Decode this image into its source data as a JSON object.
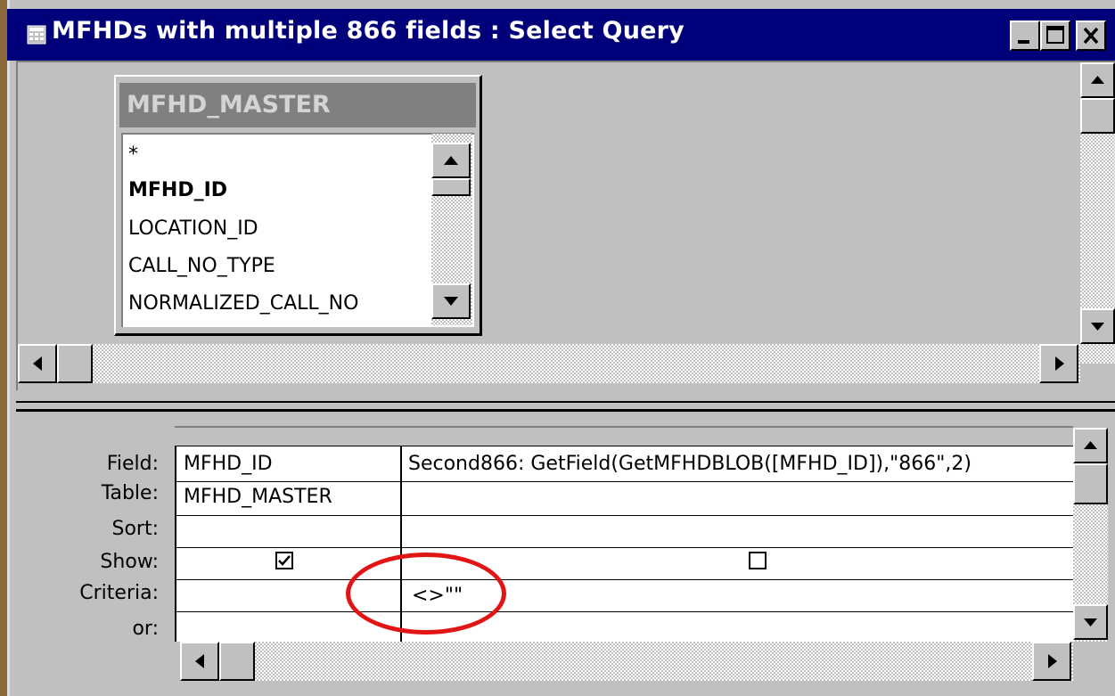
{
  "window": {
    "title": "MFHDs with multiple 866 fields : Select Query"
  },
  "table_box": {
    "title": "MFHD_MASTER",
    "fields": [
      "*",
      "MFHD_ID",
      "LOCATION_ID",
      "CALL_NO_TYPE",
      "NORMALIZED_CALL_NO"
    ],
    "bold_field": "MFHD_ID"
  },
  "grid": {
    "row_labels": [
      "Field:",
      "Table:",
      "Sort:",
      "Show:",
      "Criteria:",
      "or:"
    ],
    "columns": [
      {
        "field": "MFHD_ID",
        "table": "MFHD_MASTER",
        "sort": "",
        "show": true,
        "criteria": "",
        "or": ""
      },
      {
        "field": "Second866: GetField(GetMFHDBLOB([MFHD_ID]),\"866\",2)",
        "table": "",
        "sort": "",
        "show": false,
        "criteria": "<>\"\"",
        "or": ""
      }
    ]
  },
  "annotation": {
    "color": "#e21414",
    "target": "criteria-cell-col2"
  },
  "colors": {
    "titlebar": "#00007b",
    "face": "#c0c0c0",
    "table_title_bg": "#808080"
  }
}
